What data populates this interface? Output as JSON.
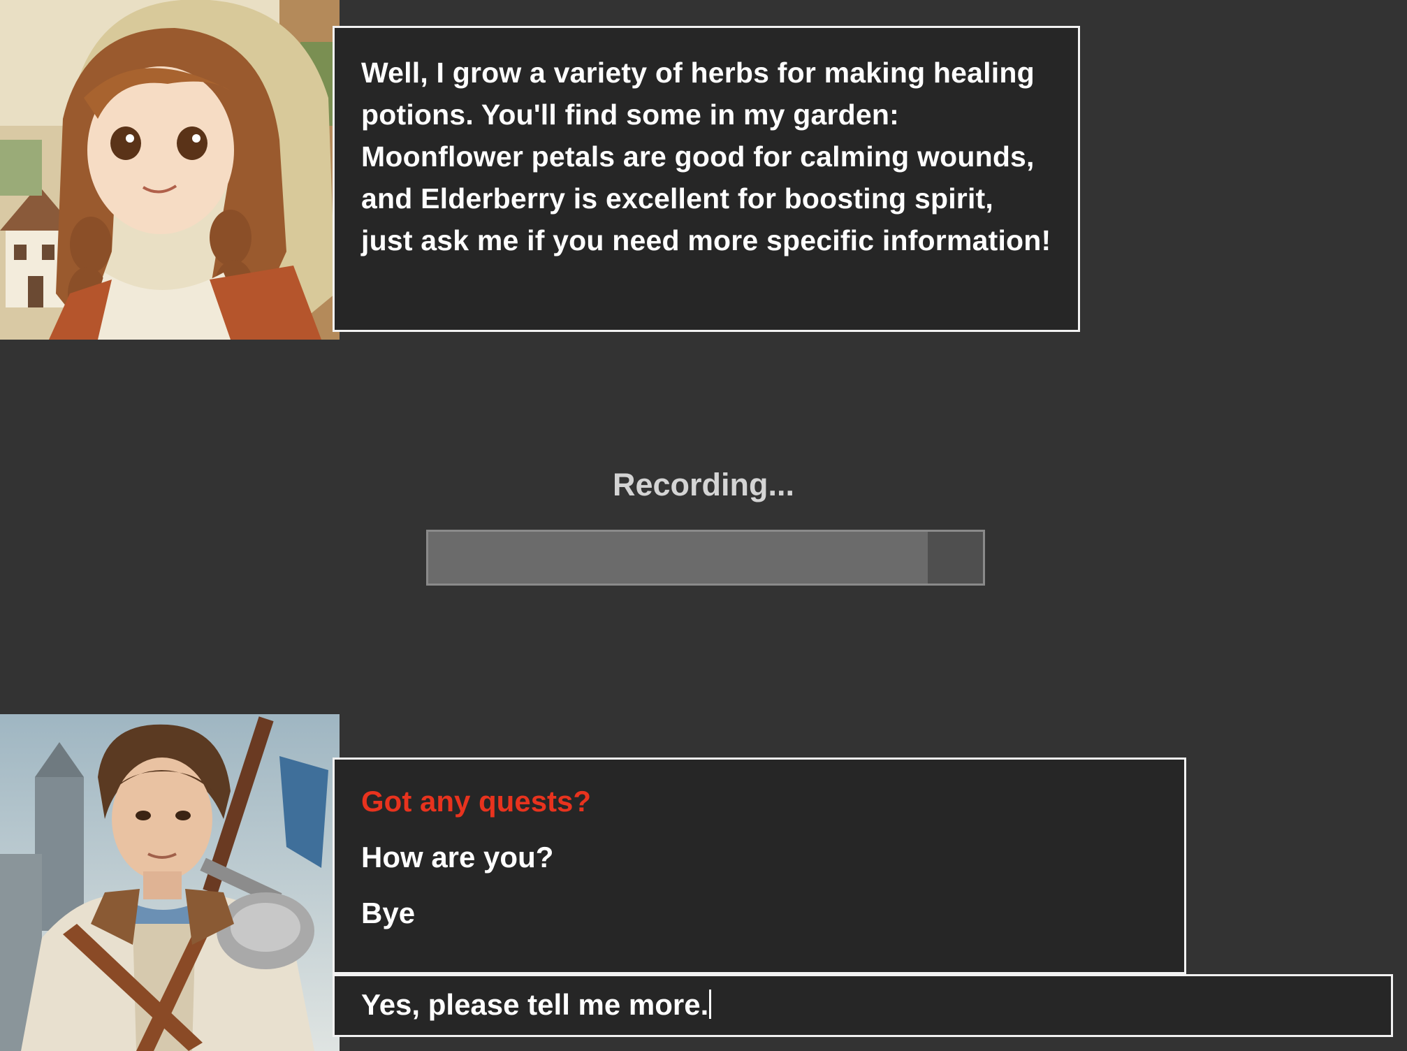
{
  "npc": {
    "portrait": "npc-herbalist-portrait",
    "dialogue": "Well, I grow a variety of herbs for making healing potions. You'll find some in my garden: Moonflower petals are good for calming wounds, and Elderberry is excellent for boosting spirit, just ask me if you need more specific information!"
  },
  "recording": {
    "label": "Recording...",
    "progress": 0.9
  },
  "player": {
    "portrait": "player-adventurer-portrait",
    "choices": [
      {
        "label": "Got any quests?",
        "selected": true
      },
      {
        "label": "How are you?",
        "selected": false
      },
      {
        "label": "Bye",
        "selected": false
      }
    ],
    "input_value": "Yes, please tell me more."
  },
  "colors": {
    "background": "#333333",
    "panel": "#262626",
    "border": "#f2f2f2",
    "selected_choice": "#e8331e",
    "bar_fill": "#6b6b6b",
    "bar_track": "#4f4f4f"
  }
}
